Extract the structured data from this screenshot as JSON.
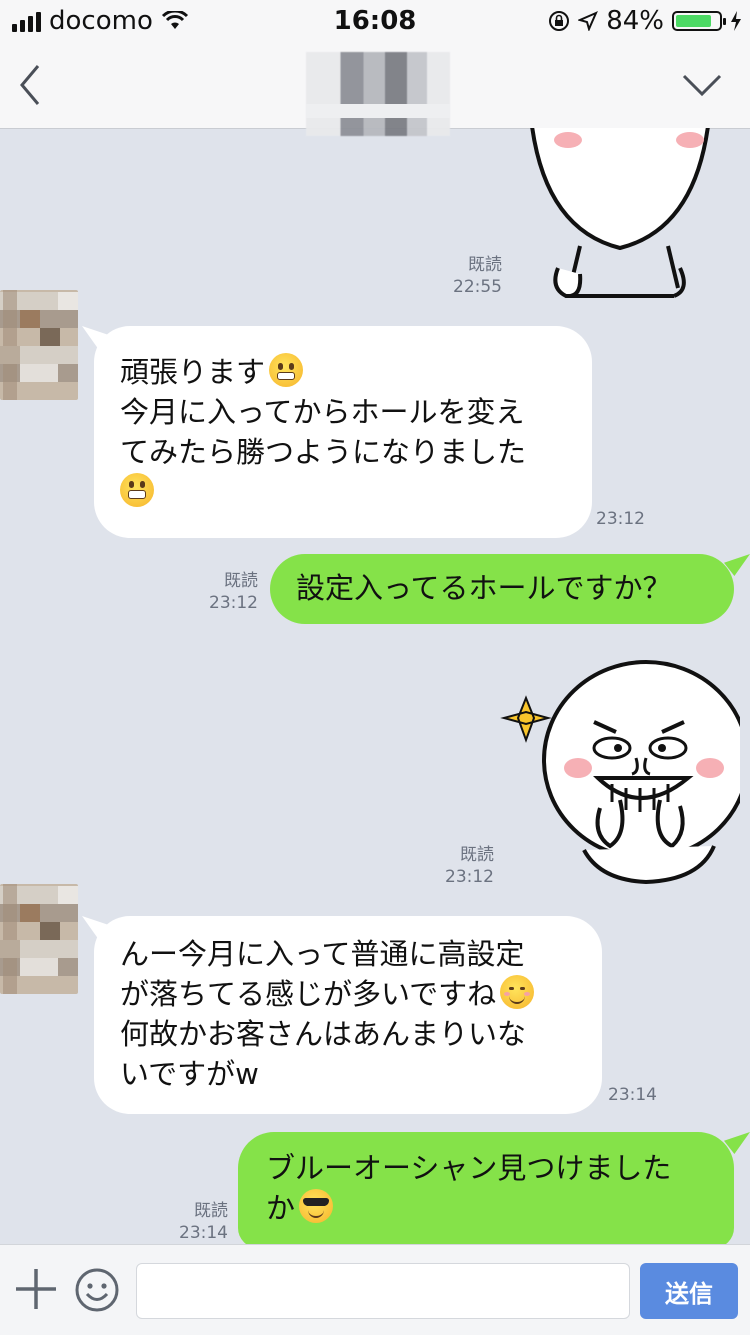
{
  "status_bar": {
    "carrier": "docomo",
    "time": "16:08",
    "battery_percent": "84%",
    "battery_level": 0.84
  },
  "nav": {
    "back_icon": "chevron-left-icon",
    "menu_icon": "chevron-down-icon"
  },
  "messages": [
    {
      "side": "out",
      "type": "sticker",
      "read": "既読",
      "time": "22:55"
    },
    {
      "side": "in",
      "type": "text",
      "lines": [
        "頑張ります",
        "今月に入ってからホールを変え",
        "てみたら勝つようになりました",
        ""
      ],
      "emojis": [
        "grimacing",
        "grin"
      ],
      "time": "23:12"
    },
    {
      "side": "out",
      "type": "text",
      "lines": [
        "設定入ってるホールですか？"
      ],
      "read": "既読",
      "time": "23:12"
    },
    {
      "side": "out",
      "type": "sticker",
      "read": "既読",
      "time": "23:12"
    },
    {
      "side": "in",
      "type": "text",
      "lines": [
        "んー今月に入って普通に高設定",
        "が落ちてる感じが多いですね",
        "何故かお客さんはあんまりいな",
        "いですがw"
      ],
      "emojis": [
        "smiling"
      ],
      "time": "23:14"
    },
    {
      "side": "out",
      "type": "text",
      "lines": [
        "ブルーオーシャン見つけました",
        "か"
      ],
      "emojis": [
        "sunglasses"
      ],
      "read": "既読",
      "time": "23:14"
    }
  ],
  "input_bar": {
    "send_label": "送信",
    "placeholder": ""
  }
}
